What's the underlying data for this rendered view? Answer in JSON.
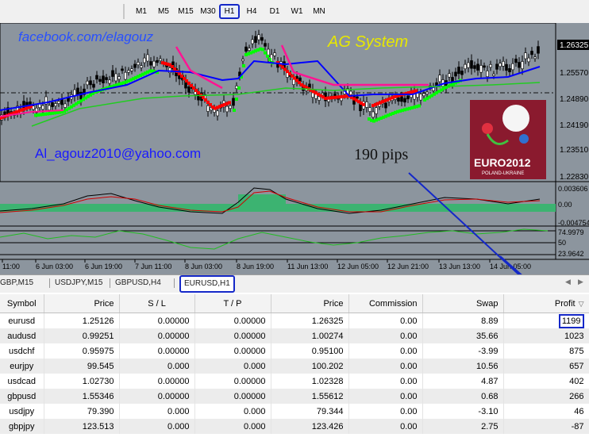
{
  "toolbar": {
    "timeframes": [
      "M1",
      "M5",
      "M15",
      "M30",
      "H1",
      "H4",
      "D1",
      "W1",
      "MN"
    ],
    "active": "H1"
  },
  "chart": {
    "facebook_text": "facebook.com/elagouz",
    "system_text": "AG System",
    "email_text": "Al_agouz2010@yahoo.com",
    "pips_text": "190 pips",
    "euro_logo_text": "EURO2012",
    "euro_logo_sub": "POLAND-UKRAINE",
    "price_labels": [
      "1.26325",
      "1.25570",
      "1.24890",
      "1.24190",
      "1.23510",
      "1.22830"
    ],
    "indicator1_labels": [
      "0.003606",
      "0.00",
      "-0.004754"
    ],
    "indicator2_labels": [
      "74.9979",
      "50",
      "23.9642"
    ],
    "time_labels": [
      "11:00",
      "6 Jun 03:00",
      "6 Jun 19:00",
      "7 Jun 11:00",
      "8 Jun 03:00",
      "8 Jun 19:00",
      "11 Jun 13:00",
      "12 Jun 05:00",
      "12 Jun 21:00",
      "13 Jun 13:00",
      "14 Jun 05:00"
    ],
    "colors": {
      "bull": "#00ff00",
      "bear": "#ff0000",
      "trend": "#0000ff",
      "signal": "#ff1493",
      "background": "#8c959e"
    }
  },
  "tabs": {
    "items": [
      "GBP,M15",
      "USDJPY,M15",
      "GBPUSD,H4",
      "EURUSD,H1"
    ],
    "active": "EURUSD,H1",
    "nav_left": "◀",
    "nav_right": "▶"
  },
  "table": {
    "columns": [
      "Symbol",
      "Price",
      "S / L",
      "T / P",
      "Price",
      "Commission",
      "Swap",
      "Profit"
    ],
    "sort_indicator": "▽",
    "rows": [
      {
        "symbol": "eurusd",
        "price": "1.25126",
        "sl": "0.00000",
        "tp": "0.00000",
        "price2": "1.26325",
        "commission": "0.00",
        "swap": "8.89",
        "profit": "1199"
      },
      {
        "symbol": "audusd",
        "price": "0.99251",
        "sl": "0.00000",
        "tp": "0.00000",
        "price2": "1.00274",
        "commission": "0.00",
        "swap": "35.66",
        "profit": "1023"
      },
      {
        "symbol": "usdchf",
        "price": "0.95975",
        "sl": "0.00000",
        "tp": "0.00000",
        "price2": "0.95100",
        "commission": "0.00",
        "swap": "-3.99",
        "profit": "875"
      },
      {
        "symbol": "eurjpy",
        "price": "99.545",
        "sl": "0.000",
        "tp": "0.000",
        "price2": "100.202",
        "commission": "0.00",
        "swap": "10.56",
        "profit": "657"
      },
      {
        "symbol": "usdcad",
        "price": "1.02730",
        "sl": "0.00000",
        "tp": "0.00000",
        "price2": "1.02328",
        "commission": "0.00",
        "swap": "4.87",
        "profit": "402"
      },
      {
        "symbol": "gbpusd",
        "price": "1.55346",
        "sl": "0.00000",
        "tp": "0.00000",
        "price2": "1.55612",
        "commission": "0.00",
        "swap": "0.68",
        "profit": "266"
      },
      {
        "symbol": "usdjpy",
        "price": "79.390",
        "sl": "0.000",
        "tp": "0.000",
        "price2": "79.344",
        "commission": "0.00",
        "swap": "-3.10",
        "profit": "46"
      },
      {
        "symbol": "gbpjpy",
        "price": "123.513",
        "sl": "0.000",
        "tp": "0.000",
        "price2": "123.426",
        "commission": "0.00",
        "swap": "2.75",
        "profit": "-87"
      }
    ]
  }
}
